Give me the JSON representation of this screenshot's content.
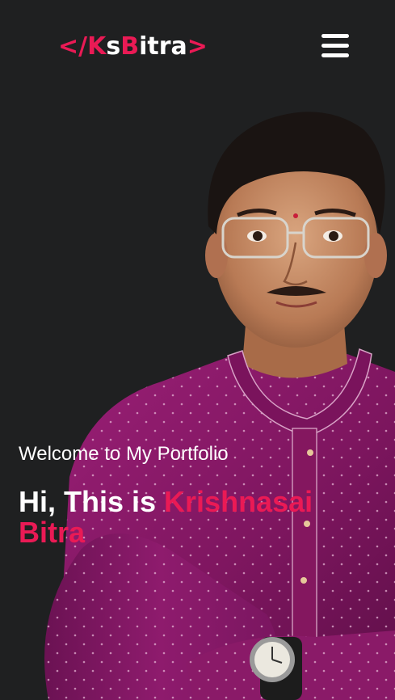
{
  "header": {
    "logo": {
      "open_bracket": "</",
      "k": "K",
      "s": "s",
      "b": "B",
      "rest": "itra",
      "close_bracket": ">"
    },
    "menu_icon": "hamburger-menu-icon"
  },
  "hero": {
    "welcome": "Welcome to My Portfolio",
    "greeting": "Hi, This is ",
    "name": "Krishnasai Bitra"
  },
  "colors": {
    "background": "#1f2021",
    "accent": "#ea1a55",
    "text": "#ffffff",
    "kurta": "#8a1a68"
  }
}
